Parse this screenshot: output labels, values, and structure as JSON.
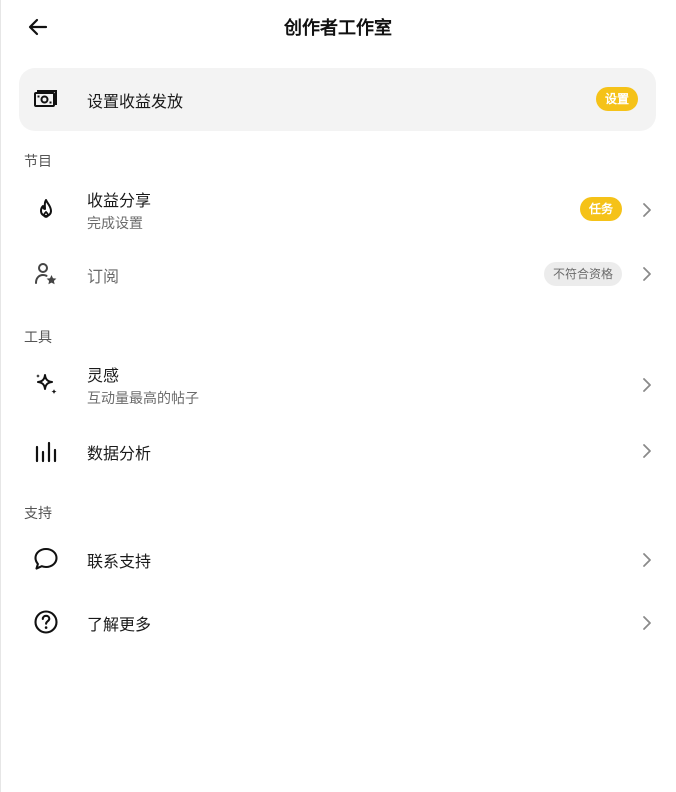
{
  "header": {
    "title": "创作者工作室",
    "back_icon": "arrow-left-icon"
  },
  "payout": {
    "label": "设置收益发放",
    "badge": "设置",
    "icon": "money-icon"
  },
  "sections": {
    "program": {
      "title": "节目",
      "items": [
        {
          "label": "收益分享",
          "sublabel": "完成设置",
          "badge": "任务",
          "icon": "flame-icon"
        },
        {
          "label": "订阅",
          "badge": "不符合资格",
          "icon": "user-star-icon"
        }
      ]
    },
    "tools": {
      "title": "工具",
      "items": [
        {
          "label": "灵感",
          "sublabel": "互动量最高的帖子",
          "icon": "sparkle-icon"
        },
        {
          "label": "数据分析",
          "icon": "bar-chart-icon"
        }
      ]
    },
    "support": {
      "title": "支持",
      "items": [
        {
          "label": "联系支持",
          "icon": "chat-bubble-icon"
        },
        {
          "label": "了解更多",
          "icon": "help-circle-icon"
        }
      ]
    }
  },
  "colors": {
    "accent": "#f5c218",
    "card_bg": "#f3f3f3",
    "muted_text": "#6b6b6b",
    "gray_pill": "#ececec"
  }
}
